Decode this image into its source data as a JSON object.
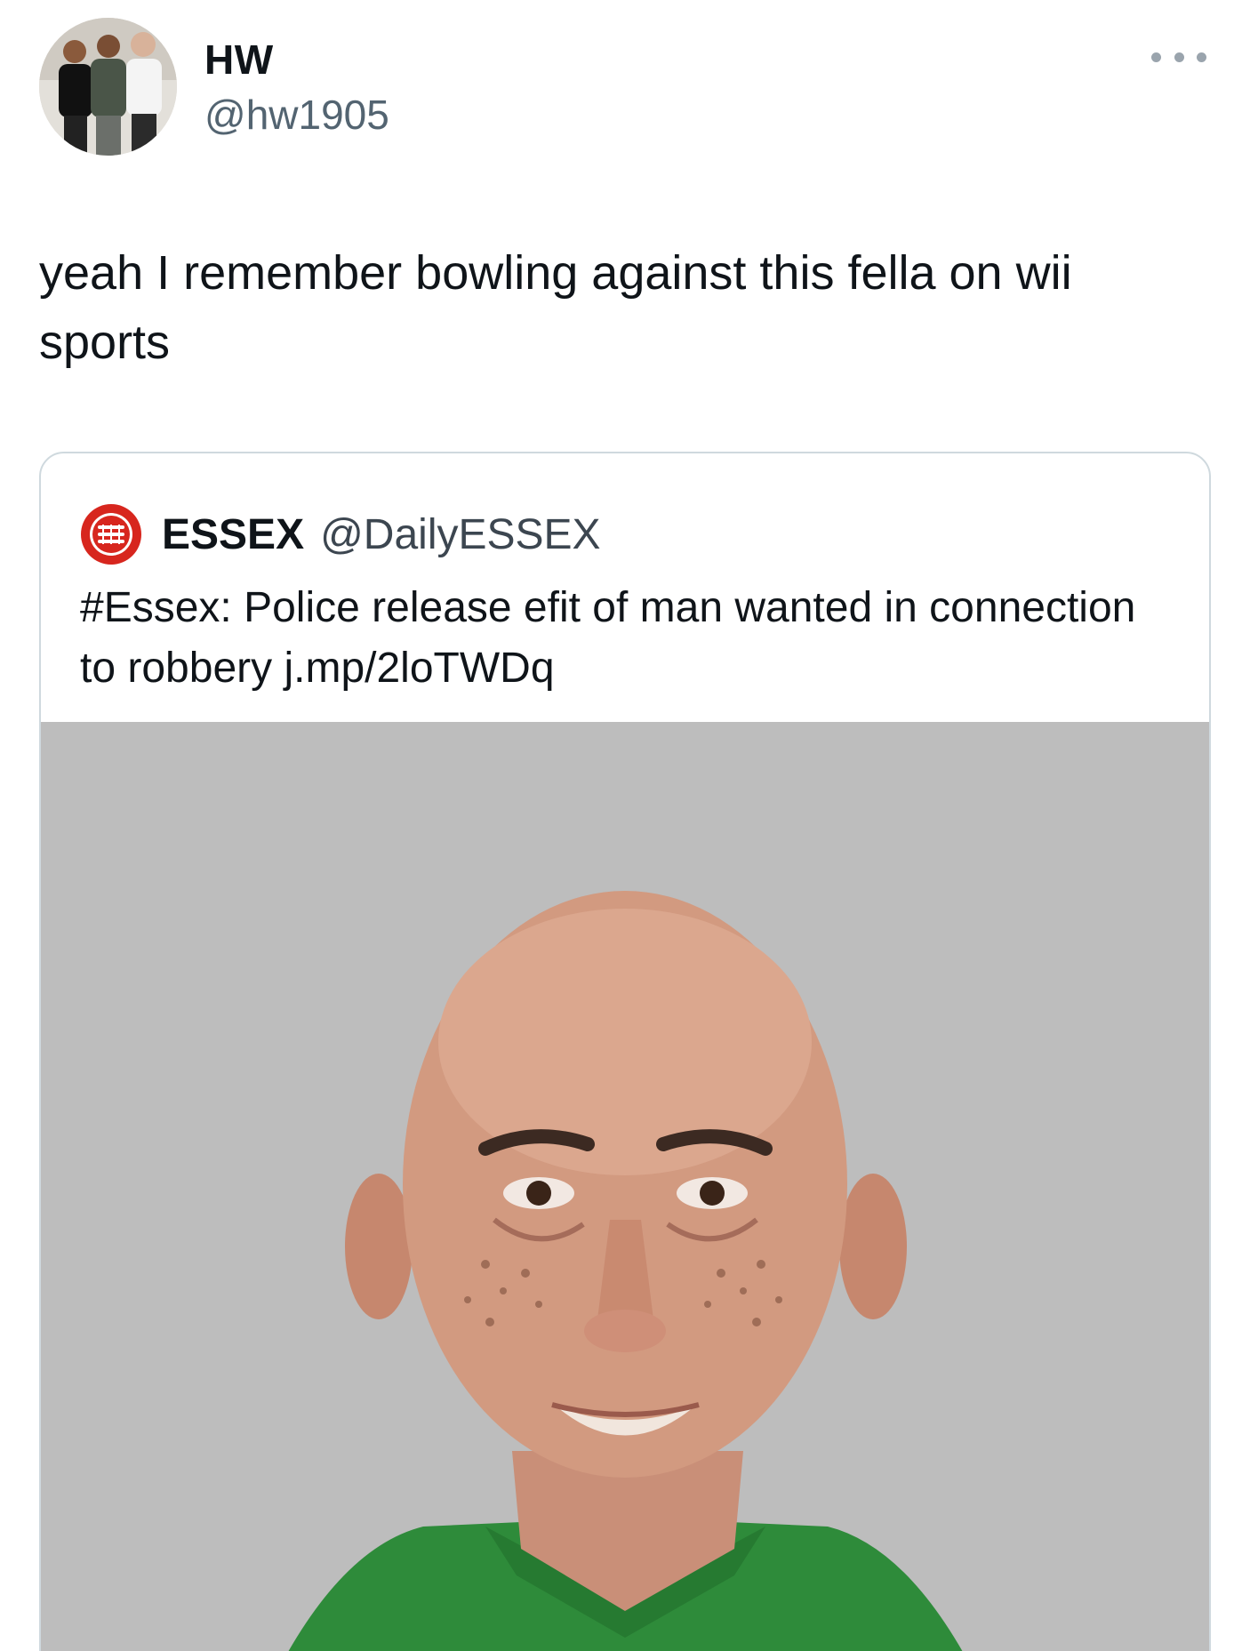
{
  "author": {
    "display_name": "HW",
    "handle": "@hw1905",
    "avatar_icon": "group-photo-avatar"
  },
  "menu_icon": "more-options-icon",
  "tweet": {
    "text": "yeah I remember bowling against this fella on wii sports"
  },
  "quoted_tweet": {
    "logo_icon": "essex-police-crest-icon",
    "display_name": "ESSEX",
    "handle": "@DailyESSEX",
    "text": "#Essex: Police release efit of man wanted in connection to robbery j.mp/2loTWDq",
    "media": {
      "kind": "efit-portrait-image",
      "background_color": "#bdbdbd",
      "shirt_color": "#2e8b3a"
    }
  },
  "colors": {
    "text_primary": "#0f1419",
    "text_secondary": "#536471",
    "card_border": "#cfd9de",
    "logo_red": "#d7261e"
  }
}
